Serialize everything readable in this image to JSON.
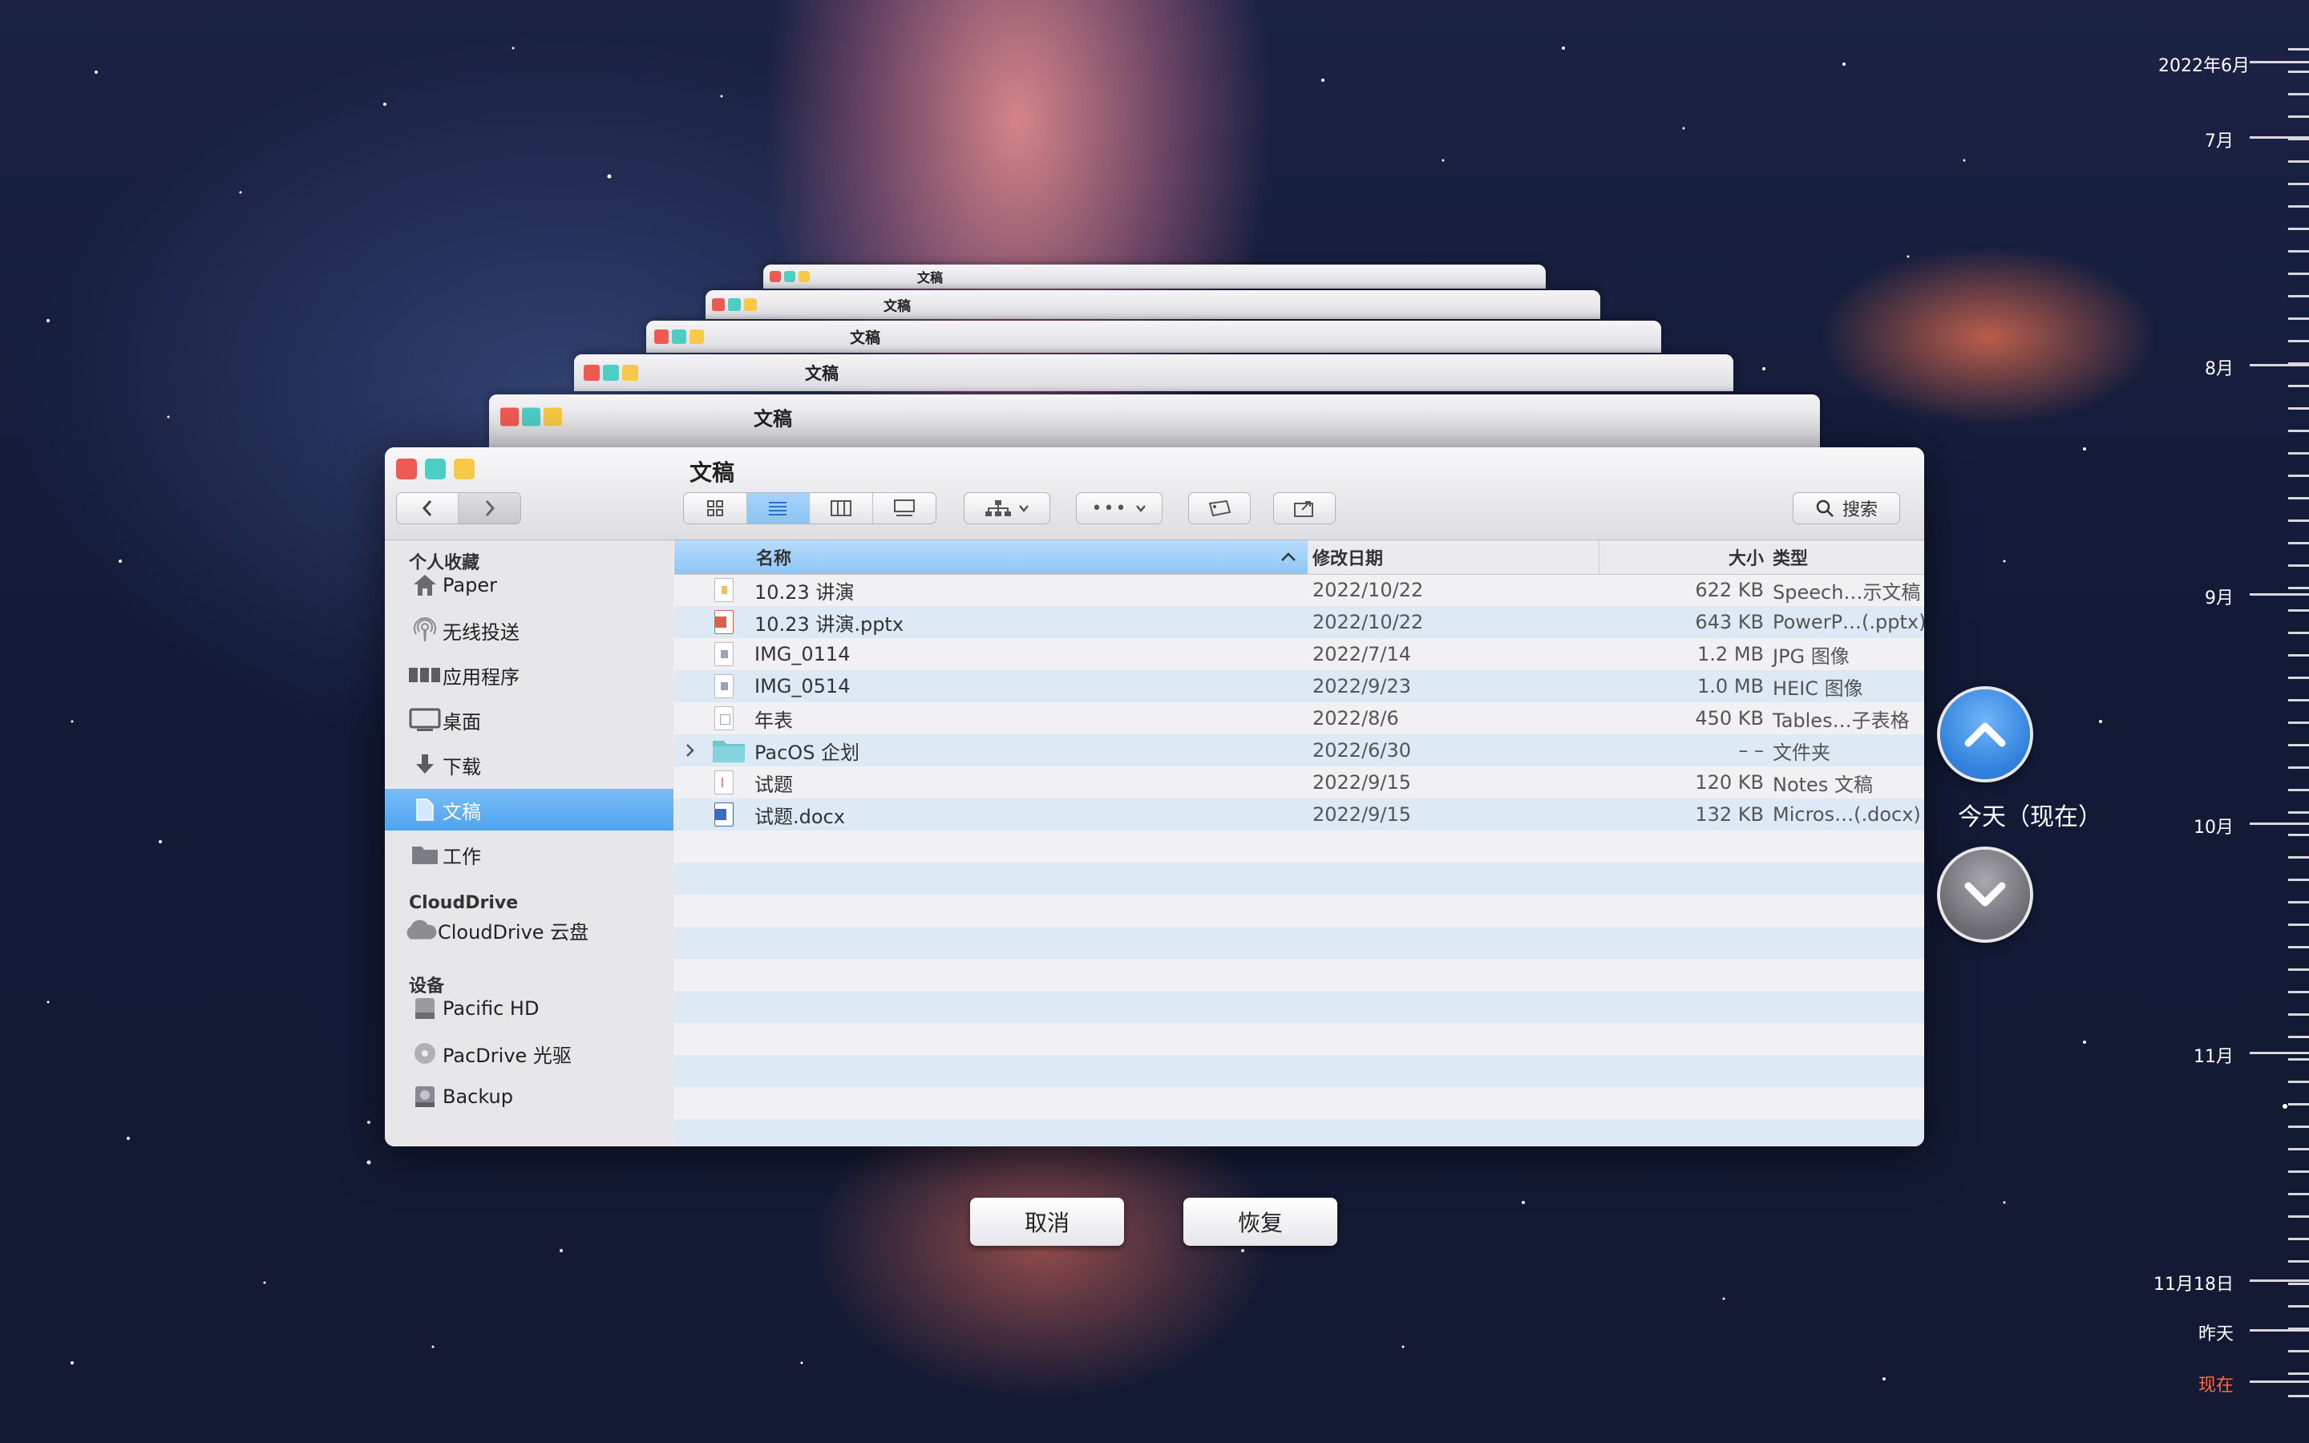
{
  "window": {
    "title": "文稿"
  },
  "ghost_windows": {
    "title": "文稿"
  },
  "toolbar": {
    "search_label": "搜索",
    "action_label": "•••"
  },
  "sidebar": {
    "sections": [
      {
        "header": "个人收藏",
        "items": [
          {
            "label": "Paper",
            "icon": "house-icon"
          },
          {
            "label": "无线投送",
            "icon": "airdrop-icon"
          },
          {
            "label": "应用程序",
            "icon": "applications-icon"
          },
          {
            "label": "桌面",
            "icon": "desktop-icon"
          },
          {
            "label": "下载",
            "icon": "download-icon"
          },
          {
            "label": "文稿",
            "icon": "document-icon",
            "selected": true
          },
          {
            "label": "工作",
            "icon": "folder-icon"
          }
        ]
      },
      {
        "header": "CloudDrive",
        "items": [
          {
            "label": "CloudDrive 云盘",
            "icon": "cloud-icon"
          }
        ]
      },
      {
        "header": "设备",
        "items": [
          {
            "label": "Pacific HD",
            "icon": "harddisk-icon"
          },
          {
            "label": "PacDrive 光驱",
            "icon": "optical-drive-icon"
          },
          {
            "label": "Backup",
            "icon": "backup-disk-icon"
          }
        ]
      }
    ]
  },
  "columns": {
    "name": "名称",
    "date": "修改日期",
    "size": "大小",
    "kind": "类型"
  },
  "files": [
    {
      "name": "10.23 讲演",
      "date": "2022/10/22",
      "size": "622 KB",
      "kind": "Speech…示文稿",
      "icon": "speech-doc-icon"
    },
    {
      "name": "10.23 讲演.pptx",
      "date": "2022/10/22",
      "size": "643 KB",
      "kind": "PowerP…(.pptx)",
      "icon": "pptx-icon"
    },
    {
      "name": "IMG_0114",
      "date": "2022/7/14",
      "size": "1.2 MB",
      "kind": "JPG 图像",
      "icon": "image-file-icon"
    },
    {
      "name": "IMG_0514",
      "date": "2022/9/23",
      "size": "1.0 MB",
      "kind": "HEIC 图像",
      "icon": "image-file-icon"
    },
    {
      "name": "年表",
      "date": "2022/8/6",
      "size": "450 KB",
      "kind": "Tables…子表格",
      "icon": "spreadsheet-icon"
    },
    {
      "name": "PacOS 企划",
      "date": "2022/6/30",
      "size": "– –",
      "kind": "文件夹",
      "icon": "folder-icon",
      "folder": true
    },
    {
      "name": "试题",
      "date": "2022/9/15",
      "size": "120 KB",
      "kind": "Notes 文稿",
      "icon": "notes-doc-icon"
    },
    {
      "name": "试题.docx",
      "date": "2022/9/15",
      "size": "132 KB",
      "kind": "Micros…(.docx)",
      "icon": "docx-icon"
    }
  ],
  "buttons": {
    "cancel": "取消",
    "restore": "恢复"
  },
  "nav": {
    "today_label": "今天（现在）"
  },
  "timeline": {
    "labels": [
      "2022年6月",
      "7月",
      "8月",
      "9月",
      "10月",
      "11月",
      "11月18日",
      "昨天",
      "现在"
    ],
    "now_color": "#ff6a3d"
  },
  "colors": {
    "accent": "#4fa3ee",
    "selection": "#8cc4f5",
    "close": "#ee5a52",
    "minimize": "#4ecdc4",
    "zoom": "#f7c948"
  }
}
